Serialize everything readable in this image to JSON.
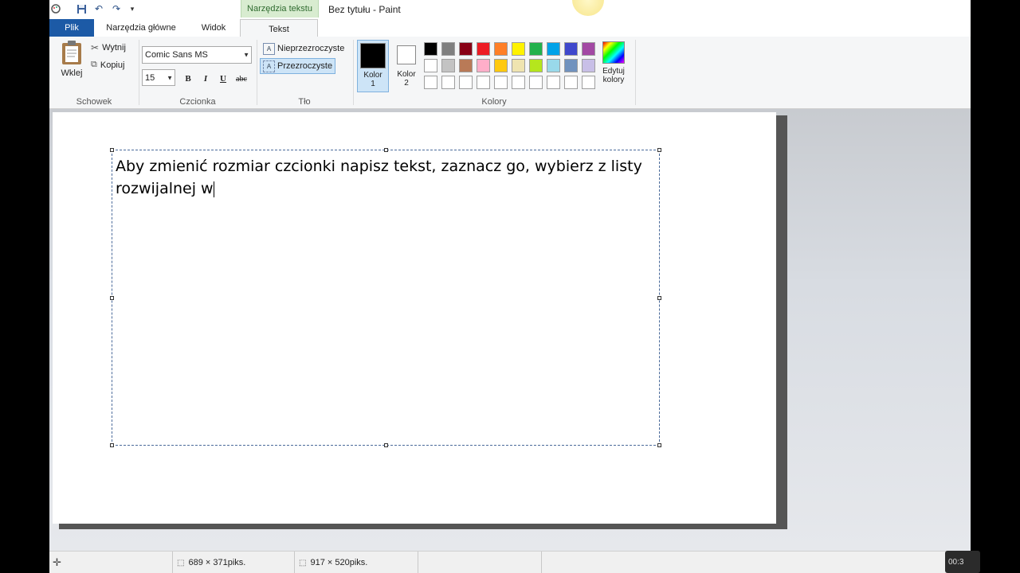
{
  "window": {
    "title": "Bez tytułu - Paint",
    "contextual_tab_header": "Narzędzia tekstu"
  },
  "tabs": [
    {
      "label": "Plik"
    },
    {
      "label": "Narzędzia główne"
    },
    {
      "label": "Widok"
    },
    {
      "label": "Tekst",
      "active": true
    }
  ],
  "ribbon": {
    "clipboard": {
      "paste_label": "Wklej",
      "cut_label": "Wytnij",
      "copy_label": "Kopiuj",
      "group_label": "Schowek"
    },
    "font": {
      "family": "Comic Sans MS",
      "size": "15",
      "bold": "B",
      "italic": "I",
      "underline": "U",
      "strikethrough": "abc",
      "group_label": "Czcionka"
    },
    "background": {
      "opaque_label": "Nieprzezroczyste",
      "transparent_label": "Przezroczyste",
      "group_label": "Tło"
    },
    "colors": {
      "color1_label_line1": "Kolor",
      "color1_label_line2": "1",
      "color2_label_line1": "Kolor",
      "color2_label_line2": "2",
      "edit_label_line1": "Edytuj",
      "edit_label_line2": "kolory",
      "group_label": "Kolory",
      "color1_value": "#000000",
      "color2_value": "#ffffff",
      "palette_row1": [
        "#000000",
        "#7f7f7f",
        "#880015",
        "#ed1c24",
        "#ff7f27",
        "#fff200",
        "#22b14c",
        "#00a2e8",
        "#3f48cc",
        "#a349a4"
      ],
      "palette_row2": [
        "#ffffff",
        "#c3c3c3",
        "#b97a57",
        "#ffaec9",
        "#ffc90e",
        "#efe4b0",
        "#b5e61d",
        "#99d9ea",
        "#7092be",
        "#c8bfe7"
      ],
      "palette_row3": [
        "#ffffff",
        "#ffffff",
        "#ffffff",
        "#ffffff",
        "#ffffff",
        "#ffffff",
        "#ffffff",
        "#ffffff",
        "#ffffff",
        "#ffffff"
      ]
    }
  },
  "canvas": {
    "text": "Aby zmienić rozmiar czcionki napisz tekst, zaznacz go, wybierz z listy rozwijalnej w"
  },
  "status": {
    "selection_size": "689 × 371piks.",
    "image_size": "917 × 520piks."
  },
  "overlay": {
    "time": "00:3"
  }
}
